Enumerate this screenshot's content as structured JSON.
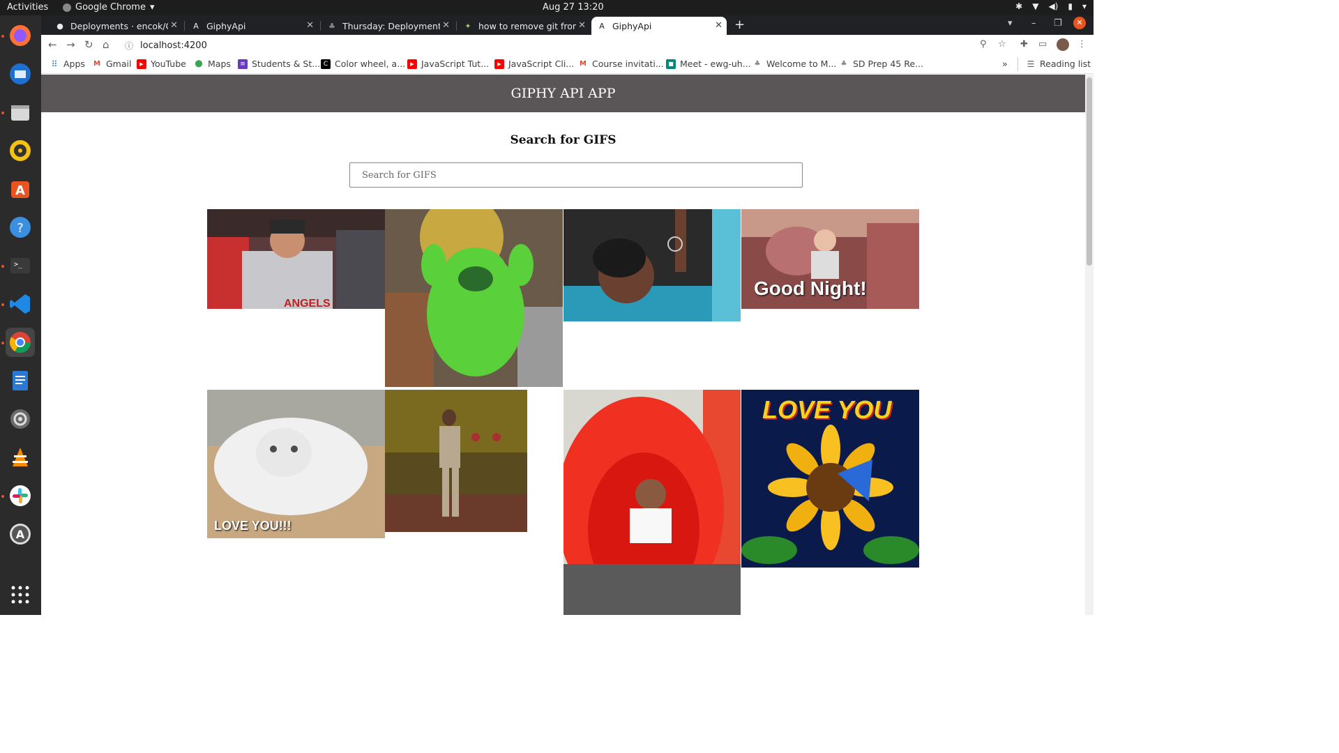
{
  "system": {
    "activities": "Activities",
    "app_name": "Google Chrome",
    "clock": "Aug 27  13:20"
  },
  "tabs": [
    {
      "title": "Deployments · encok/Gip",
      "active": false
    },
    {
      "title": "GiphyApi",
      "active": false
    },
    {
      "title": "Thursday: Deployment: SE",
      "active": false
    },
    {
      "title": "how to remove git from a",
      "active": false
    },
    {
      "title": "GiphyApi",
      "active": true
    }
  ],
  "address": {
    "url": "localhost:4200"
  },
  "bookmarks": [
    {
      "label": "Apps",
      "icon": "apps-grid-icon",
      "color": "#1a73e8"
    },
    {
      "label": "Gmail",
      "icon": "gmail-icon",
      "color": "#ea4335"
    },
    {
      "label": "YouTube",
      "icon": "youtube-icon",
      "color": "#ff0000"
    },
    {
      "label": "Maps",
      "icon": "maps-icon",
      "color": "#34a853"
    },
    {
      "label": "Students & St...",
      "icon": "list-icon",
      "color": "#673ab7"
    },
    {
      "label": "Color wheel, a...",
      "icon": "color-wheel-icon",
      "color": "#000000"
    },
    {
      "label": "JavaScript Tut...",
      "icon": "youtube-icon",
      "color": "#ff0000"
    },
    {
      "label": "JavaScript Cli...",
      "icon": "youtube-icon",
      "color": "#ff0000"
    },
    {
      "label": "Course invitati...",
      "icon": "gmail-icon",
      "color": "#ea4335"
    },
    {
      "label": "Meet - ewg-uh...",
      "icon": "meet-icon",
      "color": "#00897b"
    },
    {
      "label": "Welcome to M...",
      "icon": "plant-icon",
      "color": "#888888"
    },
    {
      "label": "SD Prep 45 Re...",
      "icon": "plant-icon",
      "color": "#888888"
    }
  ],
  "reading_list": "Reading list",
  "app": {
    "header_title": "GIPHY API APP",
    "search_heading": "Search for GIFS",
    "search_placeholder": "Search for GIFS",
    "search_value": ""
  },
  "gifs": [
    {
      "name": "baseball-player",
      "caption": "",
      "color": "#8a4a48"
    },
    {
      "name": "green-pig",
      "caption": "",
      "color": "#5cc840"
    },
    {
      "name": "swimmer",
      "caption": "",
      "color": "#2a8aa8"
    },
    {
      "name": "good-night-baby",
      "caption": "Good Night!",
      "color": "#9a5a58"
    },
    {
      "name": "cat-love-you",
      "caption": "LOVE YOU!!!",
      "color": "#b8aa98"
    },
    {
      "name": "dancing-woman",
      "caption": "",
      "color": "#6a5a28"
    },
    {
      "name": "baby-slide",
      "caption": "",
      "color": "#e84830"
    },
    {
      "name": "sunflower-love-you",
      "caption": "LOVE YOU",
      "color": "#1a2a6a"
    }
  ]
}
